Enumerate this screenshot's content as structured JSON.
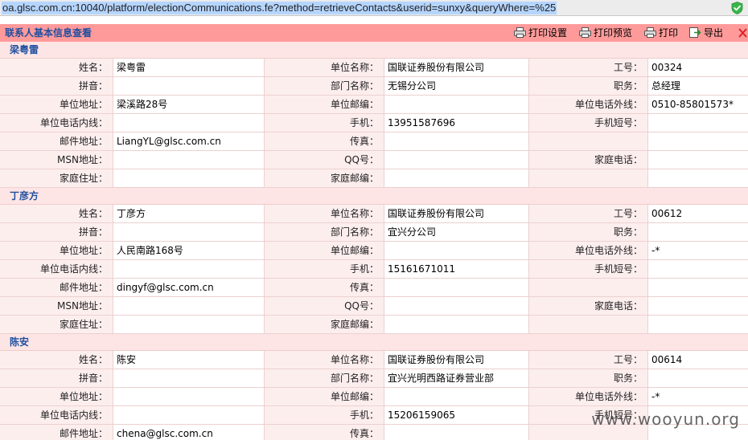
{
  "browser": {
    "url": "oa.glsc.com.cn:10040/platform/electionCommunications.fe?method=retrieveContacts&userid=sunxy&queryWhere=%25"
  },
  "toolbar": {
    "title": "联系人基本信息查看",
    "print_setup_label": "打印设置",
    "print_preview_label": "打印预览",
    "print_label": "打印",
    "export_label": "导出"
  },
  "contacts": [
    {
      "name": "梁粤雷",
      "rows": [
        [
          {
            "label": "姓名：",
            "value": "梁粤雷"
          },
          {
            "label": "单位名称：",
            "value": "国联证券股份有限公司"
          },
          {
            "label": "工号：",
            "value": "00324"
          }
        ],
        [
          {
            "label": "拼音：",
            "value": ""
          },
          {
            "label": "部门名称：",
            "value": "无锡分公司"
          },
          {
            "label": "职务：",
            "value": "总经理"
          }
        ],
        [
          {
            "label": "单位地址：",
            "value": "梁溪路28号"
          },
          {
            "label": "单位邮编：",
            "value": ""
          },
          {
            "label": "单位电话外线：",
            "value": "0510-85801573*"
          }
        ],
        [
          {
            "label": "单位电话内线：",
            "value": ""
          },
          {
            "label": "手机：",
            "value": "13951587696"
          },
          {
            "label": "手机短号：",
            "value": ""
          }
        ],
        [
          {
            "label": "邮件地址：",
            "value": "LiangYL@glsc.com.cn"
          },
          {
            "label": "传真：",
            "value": ""
          },
          {
            "label": "",
            "value": ""
          }
        ],
        [
          {
            "label": "MSN地址：",
            "value": ""
          },
          {
            "label": "QQ号：",
            "value": ""
          },
          {
            "label": "家庭电话：",
            "value": ""
          }
        ],
        [
          {
            "label": "家庭住址：",
            "value": ""
          },
          {
            "label": "家庭邮编：",
            "value": ""
          },
          {
            "label": "",
            "value": ""
          }
        ]
      ]
    },
    {
      "name": "丁彦方",
      "rows": [
        [
          {
            "label": "姓名：",
            "value": "丁彦方"
          },
          {
            "label": "单位名称：",
            "value": "国联证券股份有限公司"
          },
          {
            "label": "工号：",
            "value": "00612"
          }
        ],
        [
          {
            "label": "拼音：",
            "value": ""
          },
          {
            "label": "部门名称：",
            "value": "宜兴分公司"
          },
          {
            "label": "职务：",
            "value": ""
          }
        ],
        [
          {
            "label": "单位地址：",
            "value": "人民南路168号"
          },
          {
            "label": "单位邮编：",
            "value": ""
          },
          {
            "label": "单位电话外线：",
            "value": "-*"
          }
        ],
        [
          {
            "label": "单位电话内线：",
            "value": ""
          },
          {
            "label": "手机：",
            "value": "15161671011"
          },
          {
            "label": "手机短号：",
            "value": ""
          }
        ],
        [
          {
            "label": "邮件地址：",
            "value": "dingyf@glsc.com.cn"
          },
          {
            "label": "传真：",
            "value": ""
          },
          {
            "label": "",
            "value": ""
          }
        ],
        [
          {
            "label": "MSN地址：",
            "value": ""
          },
          {
            "label": "QQ号：",
            "value": ""
          },
          {
            "label": "家庭电话：",
            "value": ""
          }
        ],
        [
          {
            "label": "家庭住址：",
            "value": ""
          },
          {
            "label": "家庭邮编：",
            "value": ""
          },
          {
            "label": "",
            "value": ""
          }
        ]
      ]
    },
    {
      "name": "陈安",
      "rows": [
        [
          {
            "label": "姓名：",
            "value": "陈安"
          },
          {
            "label": "单位名称：",
            "value": "国联证券股份有限公司"
          },
          {
            "label": "工号：",
            "value": "00614"
          }
        ],
        [
          {
            "label": "拼音：",
            "value": ""
          },
          {
            "label": "部门名称：",
            "value": "宜兴光明西路证券营业部"
          },
          {
            "label": "职务：",
            "value": ""
          }
        ],
        [
          {
            "label": "单位地址：",
            "value": ""
          },
          {
            "label": "单位邮编：",
            "value": ""
          },
          {
            "label": "单位电话外线：",
            "value": "-*"
          }
        ],
        [
          {
            "label": "单位电话内线：",
            "value": ""
          },
          {
            "label": "手机：",
            "value": "15206159065"
          },
          {
            "label": "手机短号：",
            "value": ""
          }
        ],
        [
          {
            "label": "邮件地址：",
            "value": "chena@glsc.com.cn"
          },
          {
            "label": "传真：",
            "value": ""
          },
          {
            "label": "",
            "value": ""
          }
        ]
      ]
    }
  ],
  "watermark": "www.wooyun.org"
}
